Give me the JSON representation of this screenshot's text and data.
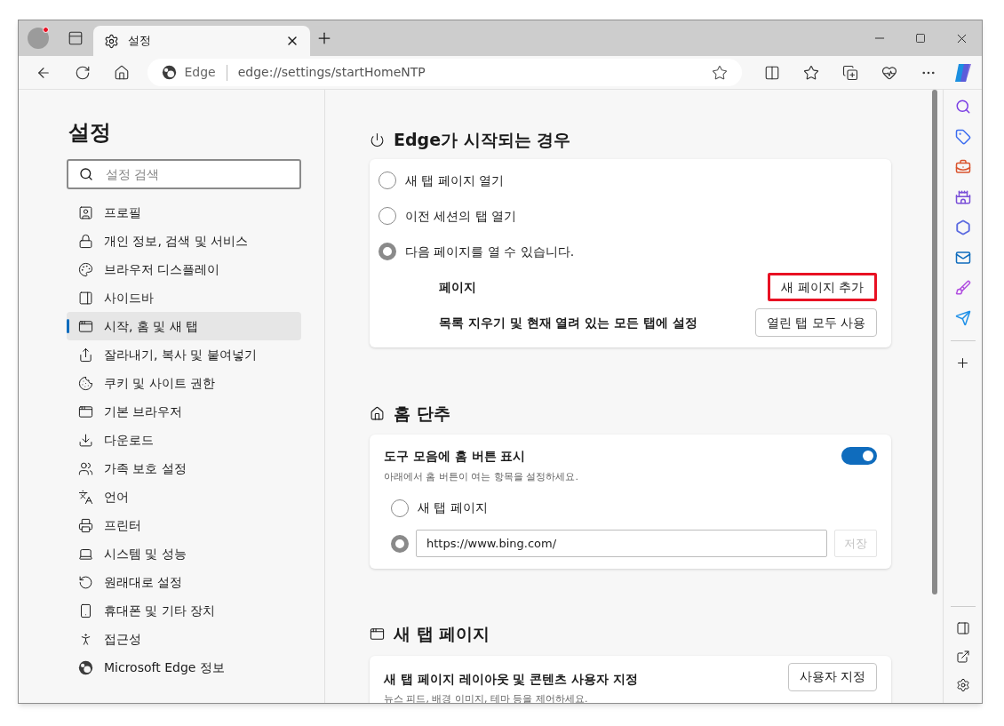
{
  "tabs": [
    {
      "title": "설정",
      "selected": true
    }
  ],
  "address_bar": {
    "site": "Edge",
    "url": "edge://settings/startHomeNTP"
  },
  "sidebar": {
    "title": "설정",
    "search": {
      "placeholder": "설정 검색"
    },
    "items": [
      {
        "label": "프로필",
        "selected": false
      },
      {
        "label": "개인 정보, 검색 및 서비스",
        "selected": false
      },
      {
        "label": "브라우저 디스플레이",
        "selected": false
      },
      {
        "label": "사이드바",
        "selected": false
      },
      {
        "label": "시작, 홈 및 새 탭",
        "selected": true
      },
      {
        "label": "잘라내기, 복사 및 붙여넣기",
        "selected": false
      },
      {
        "label": "쿠키 및 사이트 권한",
        "selected": false
      },
      {
        "label": "기본 브라우저",
        "selected": false
      },
      {
        "label": "다운로드",
        "selected": false
      },
      {
        "label": "가족 보호 설정",
        "selected": false
      },
      {
        "label": "언어",
        "selected": false
      },
      {
        "label": "프린터",
        "selected": false
      },
      {
        "label": "시스템 및 성능",
        "selected": false
      },
      {
        "label": "원래대로 설정",
        "selected": false
      },
      {
        "label": "휴대폰 및 기타 장치",
        "selected": false
      },
      {
        "label": "접근성",
        "selected": false
      },
      {
        "label": "Microsoft Edge 정보",
        "selected": false
      }
    ]
  },
  "startup": {
    "title": "Edge가 시작되는 경우",
    "options": [
      {
        "label": "새 탭 페이지 열기",
        "selected": false
      },
      {
        "label": "이전 세션의 탭 열기",
        "selected": false
      },
      {
        "label": "다음 페이지를 열 수 있습니다.",
        "selected": true
      }
    ],
    "rows": [
      {
        "label": "페이지",
        "button": "새 페이지 추가",
        "highlighted": true
      },
      {
        "label": "목록 지우기 및 현재 열려 있는 모든 탭에 설정",
        "button": "열린 탭 모두 사용",
        "highlighted": false
      }
    ]
  },
  "home_button": {
    "title": "홈 단추",
    "toggle": {
      "label": "도구 모음에 홈 버튼 표시",
      "on": true
    },
    "description": "아래에서 홈 버튼이 여는 항목을 설정하세요.",
    "options": [
      {
        "kind": "label",
        "label": "새 탭 페이지",
        "selected": false
      },
      {
        "kind": "url",
        "value": "https://www.bing.com/",
        "selected": true
      }
    ],
    "save_button": {
      "label": "저장",
      "disabled": true
    }
  },
  "new_tab": {
    "title": "새 탭 페이지",
    "row": {
      "label": "새 탭 페이지 레이아웃 및 콘텐츠 사용자 지정",
      "description": "뉴스 피드, 배경 이미지, 테마 등을 제어하세요.",
      "button": "사용자 지정"
    }
  }
}
